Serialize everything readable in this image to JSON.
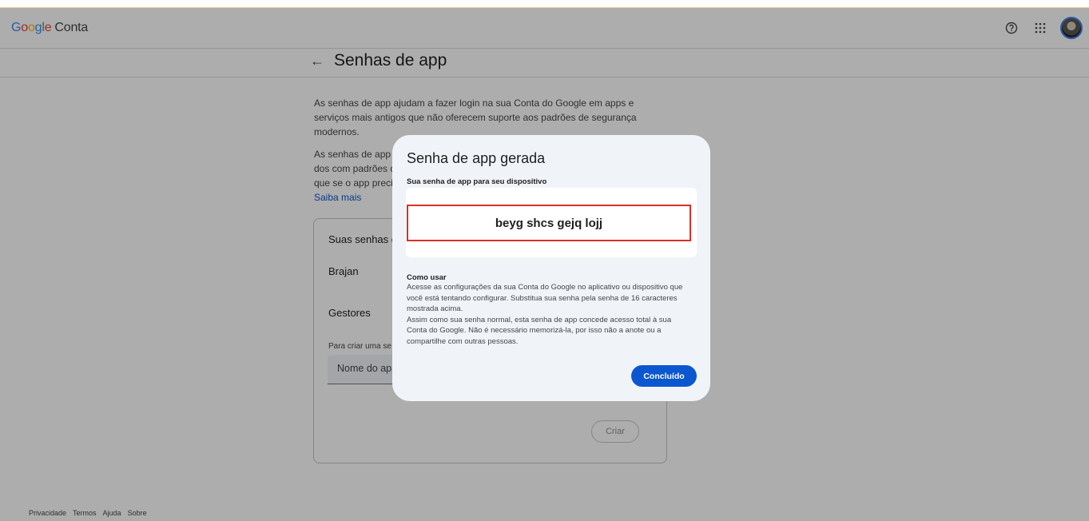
{
  "header": {
    "logo_google": [
      "G",
      "o",
      "o",
      "g",
      "l",
      "e"
    ],
    "product": "Conta",
    "help_icon": "help-circle-icon",
    "apps_icon": "apps-grid-icon"
  },
  "page": {
    "title": "Senhas de app",
    "intro1": "As senhas de app ajudam a fazer login na sua Conta do Google em apps e serviços mais antigos que não oferecem suporte aos padrões de segurança modernos.",
    "intro2_visible": "As senhas de app s",
    "intro2_line2": "dos com padrões d",
    "intro2_line3": "que se o app precis",
    "learn_more": "Saiba mais"
  },
  "card": {
    "title": "Suas senhas de",
    "items": [
      "Brajan",
      "Gestores"
    ],
    "hint": "Para criar uma se",
    "input_placeholder": "Nome do app",
    "create_button": "Criar"
  },
  "footer": {
    "links": [
      "Privacidade",
      "Termos",
      "Ajuda",
      "Sobre"
    ]
  },
  "dialog": {
    "title": "Senha de app gerada",
    "subtitle": "Sua senha de app para seu dispositivo",
    "password": "beyg shcs gejq lojj",
    "how_title": "Como usar",
    "how_text_1": "Acesse as configurações da sua Conta do Google no aplicativo ou dispositivo que você está tentando configurar. Substitua sua senha pela senha de 16 caracteres mostrada acima.",
    "how_text_2": "Assim como sua senha normal, esta senha de app concede acesso total à sua Conta do Google. Não é necessário memorizá-la, por isso não a anote ou a compartilhe com outras pessoas.",
    "done_button": "Concluído"
  },
  "colors": {
    "accent": "#0b57d0",
    "highlight_border": "#d93025"
  }
}
